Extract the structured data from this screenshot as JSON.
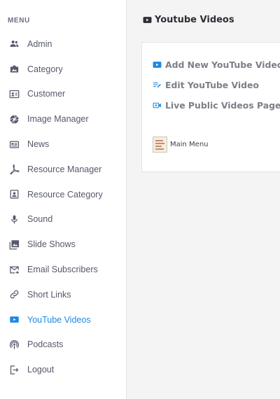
{
  "sidebar": {
    "heading": "MENU",
    "items": [
      {
        "label": "Admin",
        "icon": "users-icon"
      },
      {
        "label": "Category",
        "icon": "category-icon"
      },
      {
        "label": "Customer",
        "icon": "id-card-icon"
      },
      {
        "label": "Image Manager",
        "icon": "aperture-icon"
      },
      {
        "label": "News",
        "icon": "news-icon"
      },
      {
        "label": "Resource Manager",
        "icon": "pdf-icon"
      },
      {
        "label": "Resource Category",
        "icon": "portrait-icon"
      },
      {
        "label": "Sound",
        "icon": "mic-icon"
      },
      {
        "label": "Slide Shows",
        "icon": "photo-library-icon"
      },
      {
        "label": "Email Subscribers",
        "icon": "email-forward-icon"
      },
      {
        "label": "Short Links",
        "icon": "link-icon"
      },
      {
        "label": "YouTube Videos",
        "icon": "youtube-icon",
        "active": true
      },
      {
        "label": "Podcasts",
        "icon": "podcast-icon"
      },
      {
        "label": "Logout",
        "icon": "logout-icon"
      }
    ]
  },
  "main": {
    "title": "Youtube Videos",
    "links": [
      {
        "label": "Add New YouTube Video",
        "icon": "youtube-icon"
      },
      {
        "label": "Edit YouTube Video",
        "icon": "edit-list-icon"
      },
      {
        "label": "Live Public Videos Page",
        "icon": "video-call-icon"
      }
    ],
    "main_menu_label": "Main Menu"
  },
  "colors": {
    "accent": "#1e88e5",
    "sidebar_text": "#55596b",
    "link_text": "#7c7f88",
    "background": "#f4f4f4"
  }
}
